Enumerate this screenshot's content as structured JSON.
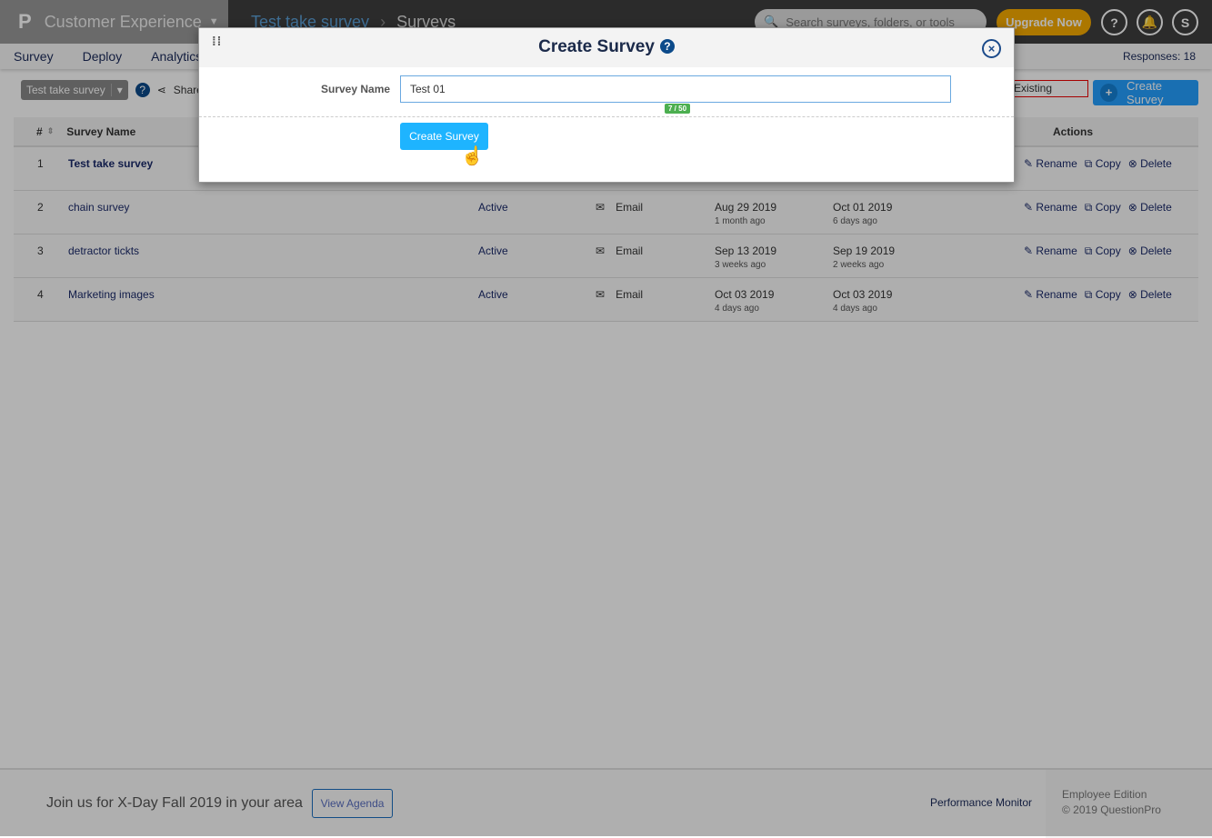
{
  "header": {
    "product": "Customer Experience",
    "breadcrumb": [
      "Test take survey",
      "Surveys"
    ],
    "search_placeholder": "Search surveys, folders, or tools",
    "upgrade": "Upgrade Now",
    "help": "?",
    "user_initial": "S"
  },
  "nav": {
    "items": [
      "Survey",
      "Deploy",
      "Analytics"
    ],
    "responses": "Responses: 18"
  },
  "toolbar": {
    "survey_select": "Test take survey",
    "share": "Share",
    "existing": "Existing Survey",
    "create": "Create Survey"
  },
  "table": {
    "headers": {
      "num": "#",
      "name": "Survey Name",
      "actions": "Actions"
    },
    "rows": [
      {
        "num": "1",
        "name": "Test take survey",
        "status": "",
        "channel": "",
        "created": "",
        "created_ago": "",
        "modified": "",
        "modified_ago": ""
      },
      {
        "num": "2",
        "name": "chain survey",
        "status": "Active",
        "channel": "Email",
        "created": "Aug 29 2019",
        "created_ago": "1 month ago",
        "modified": "Oct 01 2019",
        "modified_ago": "6 days ago"
      },
      {
        "num": "3",
        "name": "detractor tickts",
        "status": "Active",
        "channel": "Email",
        "created": "Sep 13 2019",
        "created_ago": "3 weeks ago",
        "modified": "Sep 19 2019",
        "modified_ago": "2 weeks ago"
      },
      {
        "num": "4",
        "name": "Marketing images",
        "status": "Active",
        "channel": "Email",
        "created": "Oct 03 2019",
        "created_ago": "4 days ago",
        "modified": "Oct 03 2019",
        "modified_ago": "4 days ago"
      }
    ],
    "actions": {
      "rename": "Rename",
      "copy": "Copy",
      "delete": "Delete"
    }
  },
  "modal": {
    "title": "Create Survey",
    "field_label": "Survey Name",
    "field_value": "Test 01",
    "counter": "7 / 50",
    "submit": "Create Survey"
  },
  "footer": {
    "promo": "Join us for X-Day Fall 2019 in your area",
    "agenda": "View Agenda",
    "perf": "Performance Monitor",
    "edition": "Employee Edition",
    "copyright": "© 2019 QuestionPro"
  }
}
